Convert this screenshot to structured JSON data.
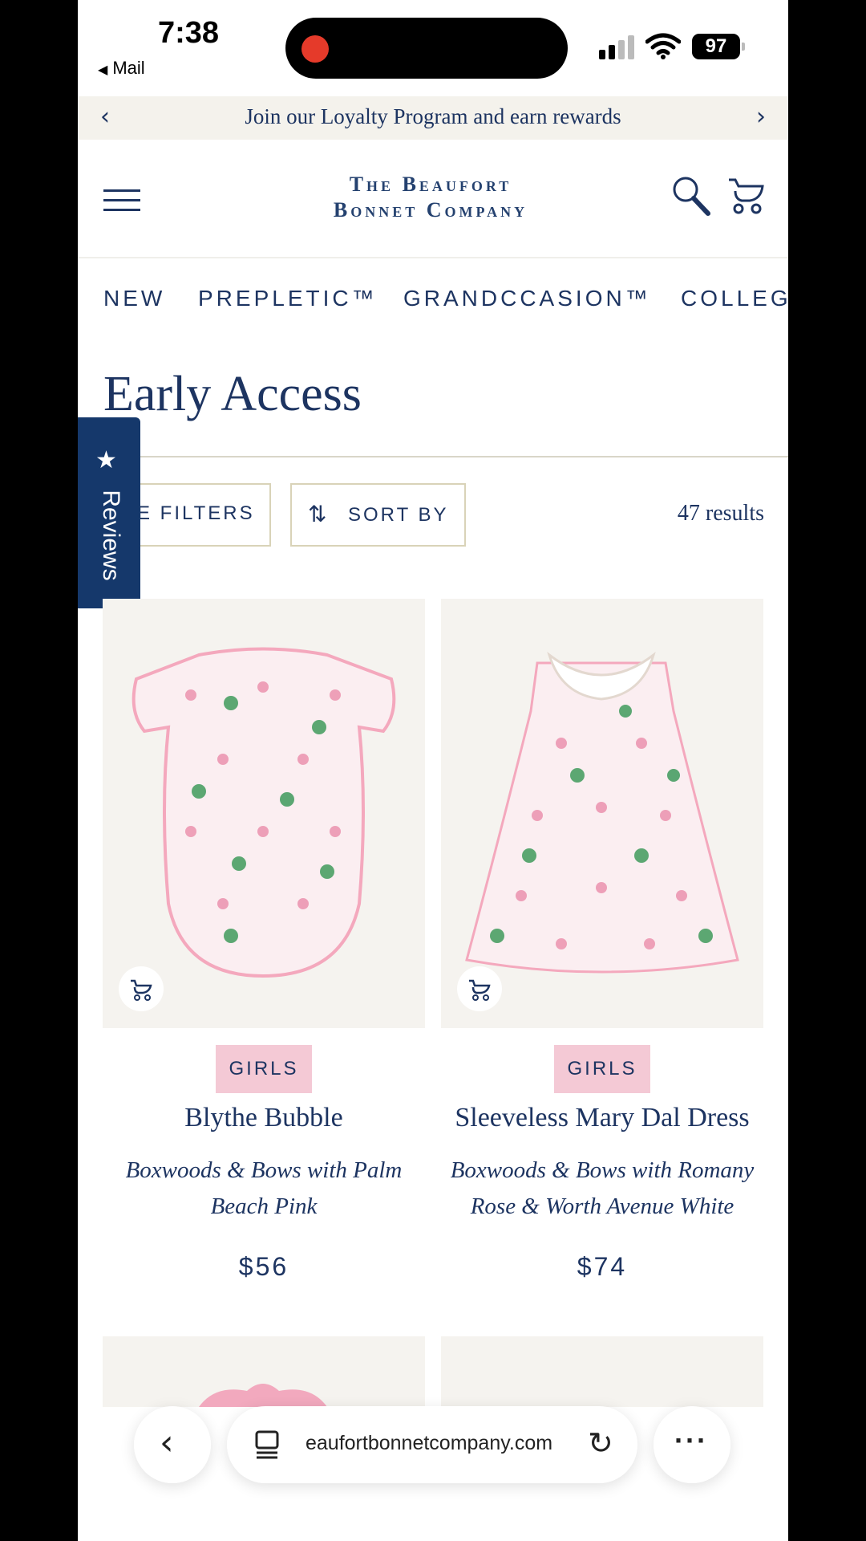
{
  "status_bar": {
    "time": "7:38",
    "back_app": "Mail",
    "battery": "97"
  },
  "promo": {
    "text": "Join our Loyalty Program and earn rewards",
    "prev": "‹",
    "next": "›"
  },
  "header": {
    "logo_line1": "The Beaufort",
    "logo_line2": "Bonnet Company"
  },
  "nav": {
    "items": [
      "NEW",
      "PREPLETIC™",
      "GRANDCCASION™",
      "COLLEG"
    ]
  },
  "page": {
    "title": "Early Access",
    "results": "47 results"
  },
  "controls": {
    "filters": "E FILTERS",
    "sort_icon": "⇅",
    "sort": "SORT BY"
  },
  "reviews_tab": {
    "star": "★",
    "label": "Reviews"
  },
  "products": [
    {
      "badge": "GIRLS",
      "name": "Blythe Bubble",
      "variant_line1": "Boxwoods & Bows with Palm",
      "variant_line2": "Beach Pink",
      "price": "$56"
    },
    {
      "badge": "GIRLS",
      "name": "Sleeveless Mary Dal Dress",
      "variant_line1": "Boxwoods & Bows with Romany",
      "variant_line2": "Rose & Worth Avenue White",
      "price": "$74"
    }
  ],
  "browser": {
    "back": "‹",
    "url": "eaufortbonnetcompany.com",
    "reload": "↻",
    "more": "···"
  },
  "colors": {
    "brand_navy": "#1d3461",
    "badge_pink": "#f4c9d5",
    "promo_bg": "#f4f2ec",
    "reviews_bg": "#15386b"
  }
}
